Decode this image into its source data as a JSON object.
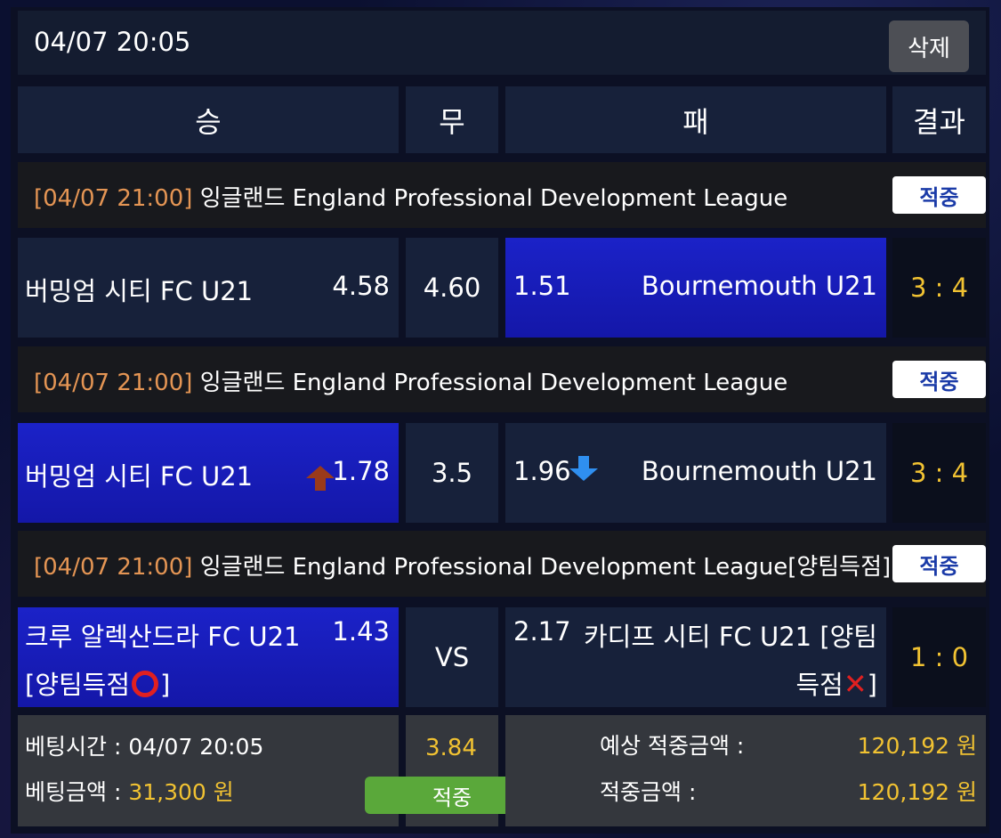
{
  "header": {
    "datetime": "04/07 20:05",
    "delete_label": "삭제"
  },
  "columns": {
    "win": "승",
    "draw": "무",
    "lose": "패",
    "result": "결과"
  },
  "matches": [
    {
      "league_time": "[04/07 21:00]",
      "league_name": "잉글랜드 England Professional Development League",
      "status": "적중",
      "home_team": "버밍엄 시티 FC U21",
      "home_odd": "4.58",
      "draw_odd": "4.60",
      "away_odd": "1.51",
      "away_team": "Bournemouth U21",
      "score": "3 : 4"
    },
    {
      "league_time": "[04/07 21:00]",
      "league_name": "잉글랜드 England Professional Development League",
      "status": "적중",
      "home_team": "버밍엄 시티 FC U21",
      "home_odd": "1.78",
      "draw_odd": "3.5",
      "away_odd": "1.96",
      "away_team": "Bournemouth U21",
      "score": "3 : 4"
    },
    {
      "league_time": "[04/07 21:00]",
      "league_name": "잉글랜드 England Professional Development League[양팀득점]",
      "status": "적중",
      "home_team_line1": "크루 알렉산드라 FC U21",
      "home_team_line2": "[양팀득점",
      "home_team_line2_end": "]",
      "home_odd": "1.43",
      "draw_odd": "VS",
      "away_odd": "2.17",
      "away_team_line1": "카디프 시티 FC U21 [양팀",
      "away_team_line2": "득점",
      "away_team_line2_end": "]",
      "score": "1 : 0"
    }
  ],
  "footer": {
    "bet_time_label": "베팅시간 : 04/07 20:05",
    "bet_amount_label": "베팅금액 : ",
    "bet_amount_value": "31,300 원",
    "total_odds": "3.84",
    "result_button": "적중",
    "expected_label": "예상 적중금액 :",
    "expected_value": "120,192 원",
    "won_label": "적중금액 :",
    "won_value": "120,192 원"
  },
  "colors": {
    "accent_orange": "#e49554",
    "gold": "#f1c232",
    "selected_blue": "#1b22c8",
    "hit_green": "#5aa83a"
  }
}
